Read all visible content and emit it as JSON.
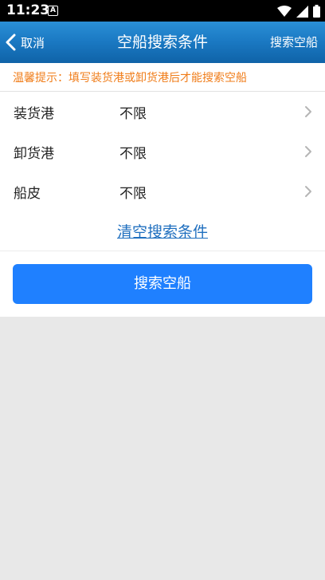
{
  "status_bar": {
    "time": "11:23",
    "notification_icon": "a-notification-icon",
    "icons": [
      "wifi-icon",
      "signal-icon",
      "battery-icon"
    ]
  },
  "header": {
    "back_label": "取消",
    "title": "空船搜索条件",
    "action_label": "搜索空船"
  },
  "tip": {
    "text": "温馨提示：填写装货港或卸货港后才能搜索空船"
  },
  "form": {
    "rows": [
      {
        "label": "装货港",
        "value": "不限"
      },
      {
        "label": "卸货港",
        "value": "不限"
      },
      {
        "label": "船皮",
        "value": "不限"
      }
    ],
    "clear_label": "清空搜索条件",
    "search_label": "搜索空船"
  },
  "colors": {
    "header_gradient_top": "#2a8fd6",
    "header_gradient_bottom": "#0f63a8",
    "tip_text": "#f07d1a",
    "link": "#1f6fbf",
    "primary_button": "#1f80ff",
    "background": "#e8e8e8"
  }
}
